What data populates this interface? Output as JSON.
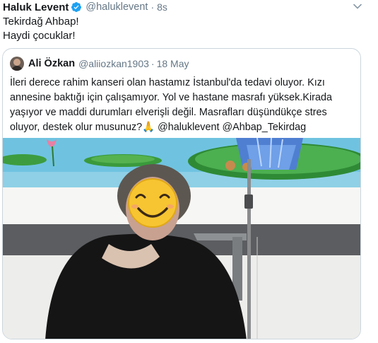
{
  "tweet": {
    "display_name": "Haluk Levent",
    "handle": "@haluklevent",
    "separator": "·",
    "time": "8s",
    "text_line1": "Tekirdağ Ahbap!",
    "text_line2": "Haydi çocuklar!"
  },
  "quoted": {
    "display_name": "Ali Özkan",
    "handle": "@aliiozkan1903",
    "separator": "·",
    "date": "18 May",
    "lines": [
      "İleri derece rahim kanseri olan hastamız İstanbul'da tedavi oluyor. Kızı",
      "annesine baktığı için çalışamıyor. Yol ve hastane masrafı yüksek.Kirada",
      "yaşıyor ve maddi durumları elverişli değil. Masrafları düşündükçe stres",
      "oluyor, destek olur musunuz?🙏 @haluklevent @Ahbap_Tekirdag"
    ]
  },
  "colors": {
    "verified": "#1da1f2",
    "secondary_text": "#657786",
    "border": "#ccd6dd"
  },
  "icons": {
    "verified": "verified-badge-icon",
    "caret": "chevron-down-icon",
    "emoji": "smiling-face-emoji"
  }
}
